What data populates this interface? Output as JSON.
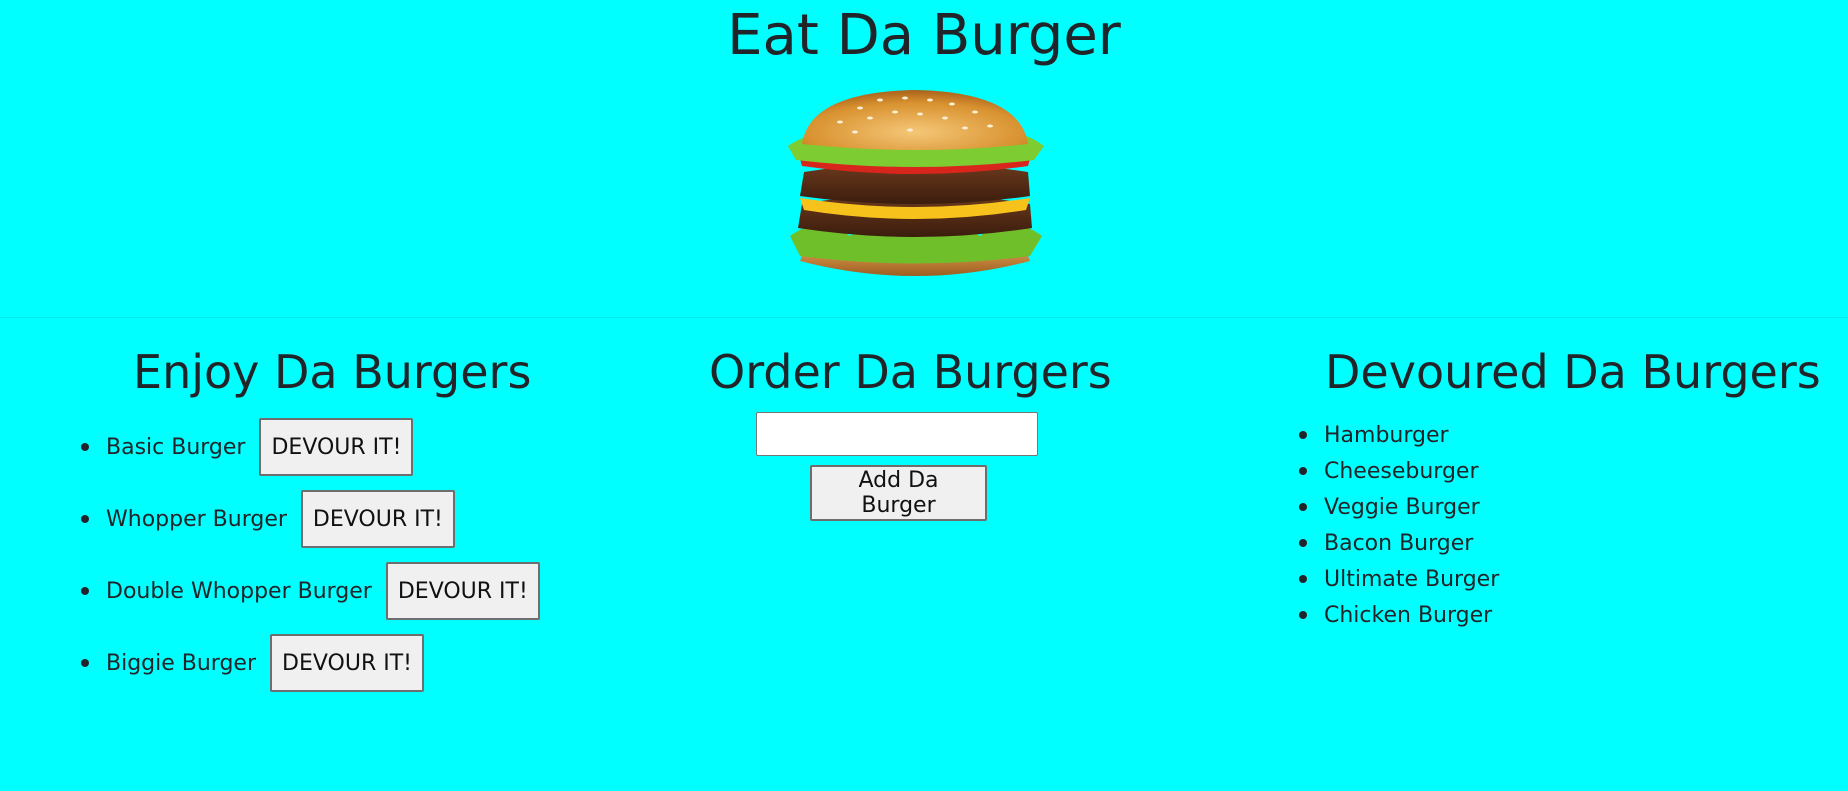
{
  "header": {
    "title": "Eat Da Burger",
    "image_icon": "burger-image"
  },
  "enjoy": {
    "title": "Enjoy Da Burgers",
    "items": [
      {
        "name": "Basic Burger",
        "button_label": "DEVOUR IT!"
      },
      {
        "name": "Whopper Burger",
        "button_label": "DEVOUR IT!"
      },
      {
        "name": "Double Whopper Burger",
        "button_label": "DEVOUR IT!"
      },
      {
        "name": "Biggie Burger",
        "button_label": "DEVOUR IT!"
      }
    ]
  },
  "order": {
    "title": "Order Da Burgers",
    "input_value": "",
    "input_placeholder": "",
    "button_label": "Add Da Burger"
  },
  "devoured": {
    "title": "Devoured Da Burgers",
    "items": [
      "Hamburger",
      "Cheeseburger",
      "Veggie Burger",
      "Bacon Burger",
      "Ultimate Burger",
      "Chicken Burger"
    ]
  },
  "colors": {
    "background": "#00ffff",
    "text": "#212529",
    "button_bg": "#f0f0f0",
    "button_border": "#6e6e6e"
  }
}
